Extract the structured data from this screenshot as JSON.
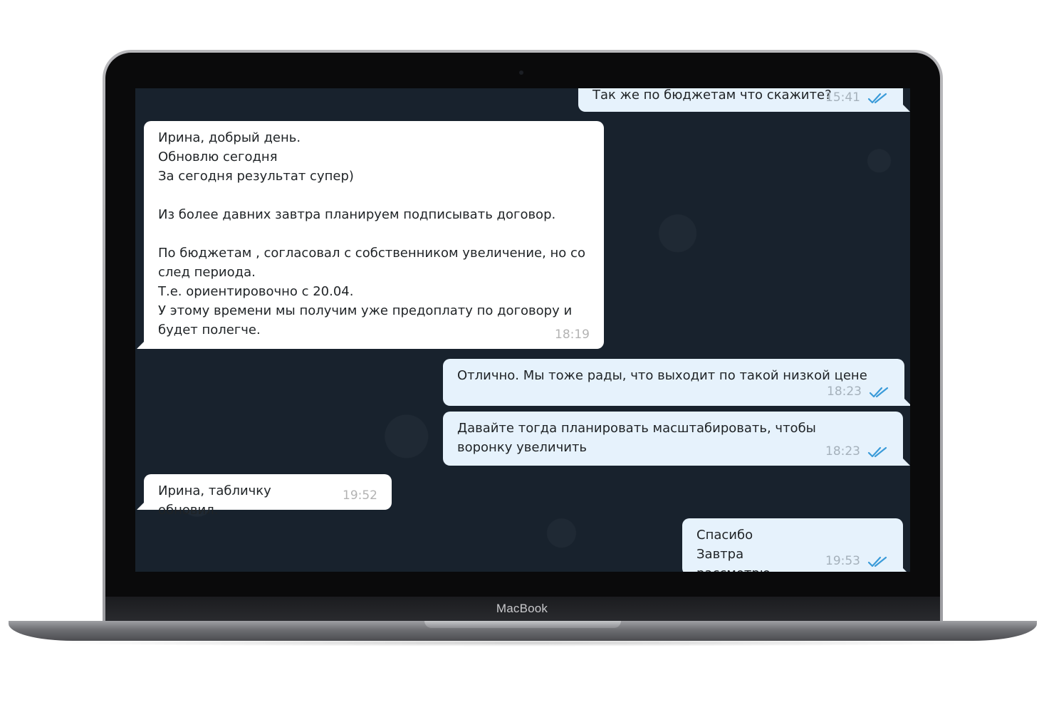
{
  "device": {
    "brand_label": "MacBook"
  },
  "chat": {
    "messages": [
      {
        "direction": "out",
        "text": "Так же по бюджетам что скажите?",
        "time": "15:41",
        "status": "read"
      },
      {
        "direction": "in",
        "text": "Ирина, добрый день.\nОбновлю сегодня\nЗа сегодня результат супер)\n\nИз более давних завтра планируем подписывать договор.\n\nПо бюджетам , согласовал с собственником увеличение, но со след периода.\nТ.е. ориентировочно с 20.04.\nУ этому времени мы получим уже предоплату по договору и будет полегче.",
        "time": "18:19"
      },
      {
        "direction": "out",
        "text": "Отлично. Мы тоже рады, что выходит по такой низкой цене",
        "time": "18:23",
        "status": "read"
      },
      {
        "direction": "out",
        "text": "Давайте тогда планировать масштабировать, чтобы воронку увеличить",
        "time": "18:23",
        "status": "read"
      },
      {
        "direction": "in",
        "text": "Ирина, табличку обновил.",
        "time": "19:52"
      },
      {
        "direction": "out",
        "text": "Спасибо\nЗавтра рассмотрю",
        "time": "19:53",
        "status": "read"
      }
    ]
  },
  "colors": {
    "chat_background": "#18222d",
    "incoming_bubble": "#ffffff",
    "outgoing_bubble": "#e6f2fc",
    "read_check": "#3a9bd9"
  },
  "icons": {
    "read_status": "double-check-icon"
  }
}
